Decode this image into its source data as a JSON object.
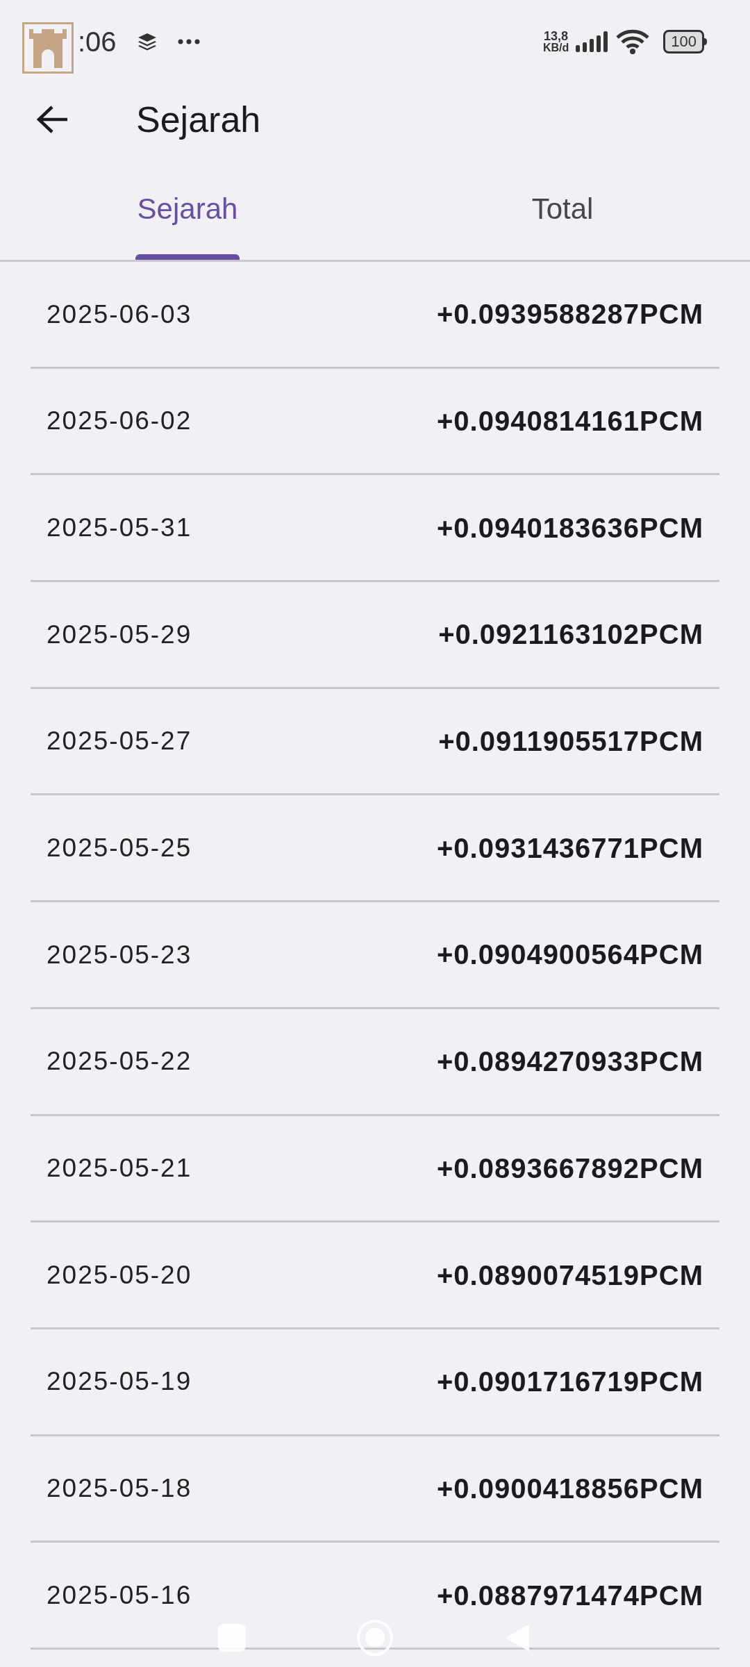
{
  "status_bar": {
    "time": ":06",
    "network_speed": "13,8",
    "network_unit": "KB/d",
    "battery": "100"
  },
  "app_bar": {
    "title": "Sejarah"
  },
  "tabs": [
    {
      "label": "Sejarah",
      "selected": true
    },
    {
      "label": "Total",
      "selected": false
    }
  ],
  "rows": [
    {
      "date": "2025-06-03",
      "amount": "+0.0939588287PCM"
    },
    {
      "date": "2025-06-02",
      "amount": "+0.0940814161PCM"
    },
    {
      "date": "2025-05-31",
      "amount": "+0.0940183636PCM"
    },
    {
      "date": "2025-05-29",
      "amount": "+0.0921163102PCM"
    },
    {
      "date": "2025-05-27",
      "amount": "+0.0911905517PCM"
    },
    {
      "date": "2025-05-25",
      "amount": "+0.0931436771PCM"
    },
    {
      "date": "2025-05-23",
      "amount": "+0.0904900564PCM"
    },
    {
      "date": "2025-05-22",
      "amount": "+0.0894270933PCM"
    },
    {
      "date": "2025-05-21",
      "amount": "+0.0893667892PCM"
    },
    {
      "date": "2025-05-20",
      "amount": "+0.0890074519PCM"
    },
    {
      "date": "2025-05-19",
      "amount": "+0.0901716719PCM"
    },
    {
      "date": "2025-05-18",
      "amount": "+0.0900418856PCM"
    },
    {
      "date": "2025-05-16",
      "amount": "+0.0887971474PCM"
    }
  ]
}
